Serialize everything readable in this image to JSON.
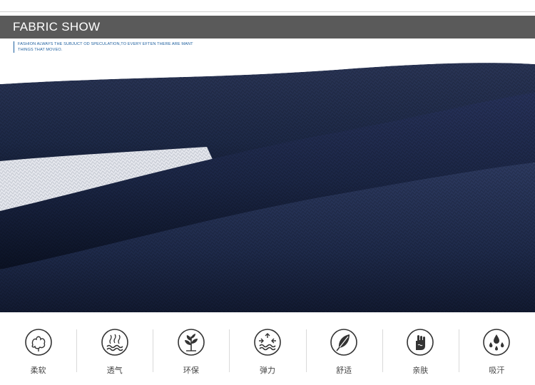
{
  "header": {
    "title": "FABRIC SHOW",
    "subtitle": "FASHION ALWAYS THE SUBJUCT OD SPECULATION,TO EVERY EFTEN THERE ARE MANT THINGS THAT MOVEO."
  },
  "colors": {
    "header_bg": "#5a5a5a",
    "subtitle_text": "#1d5f9e",
    "fabric_navy": "#1c2844",
    "fabric_white": "#e6e8ee"
  },
  "features": [
    {
      "icon": "cotton-icon",
      "label": "柔软"
    },
    {
      "icon": "breathable-waves-icon",
      "label": "透气"
    },
    {
      "icon": "plant-icon",
      "label": "环保"
    },
    {
      "icon": "stretch-arrows-icon",
      "label": "弹力"
    },
    {
      "icon": "feather-icon",
      "label": "舒适"
    },
    {
      "icon": "skin-hand-icon",
      "label": "亲肤"
    },
    {
      "icon": "sweat-drops-icon",
      "label": "吸汗"
    }
  ]
}
